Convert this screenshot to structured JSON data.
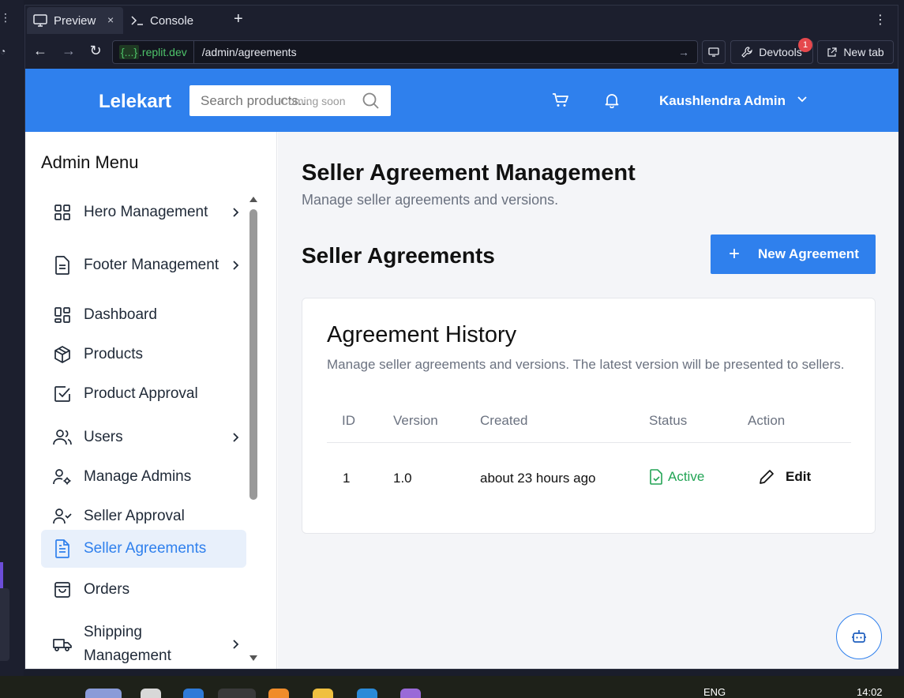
{
  "ide": {
    "tabs": [
      {
        "label": "Preview"
      },
      {
        "label": "Console"
      }
    ],
    "close_glyph": "×",
    "plus_glyph": "+",
    "url_host": "{...}",
    "url_host_suffix": ".replit.dev",
    "url_path": "/admin/agreements",
    "devtools_label": "Devtools",
    "devtools_badge": "1",
    "newtab_label": "New tab"
  },
  "topbar": {
    "brand": "Lelekart",
    "search_placeholder": "Search products...",
    "search_hint": "Coming soon",
    "user_name": "Kaushlendra Admin",
    "accent": "#2f80ed"
  },
  "sidebar": {
    "title": "Admin Menu",
    "items": [
      {
        "label": "Hero Management",
        "icon": "grid-icon",
        "chevron": true,
        "active": false
      },
      {
        "label": "Footer Management",
        "icon": "file-icon",
        "chevron": true,
        "active": false
      },
      {
        "label": "Dashboard",
        "icon": "dashboard-icon",
        "chevron": false,
        "active": false
      },
      {
        "label": "Products",
        "icon": "box-icon",
        "chevron": false,
        "active": false
      },
      {
        "label": "Product Approval",
        "icon": "check-square-icon",
        "chevron": false,
        "active": false
      },
      {
        "label": "Users",
        "icon": "users-icon",
        "chevron": true,
        "active": false
      },
      {
        "label": "Manage Admins",
        "icon": "user-cog-icon",
        "chevron": false,
        "active": false
      },
      {
        "label": "Seller Approval",
        "icon": "user-check-icon",
        "chevron": false,
        "active": false
      },
      {
        "label": "Seller Agreements",
        "icon": "file-text-icon",
        "chevron": false,
        "active": true
      },
      {
        "label": "Orders",
        "icon": "shopping-bag-icon",
        "chevron": false,
        "active": false
      },
      {
        "label": "Shipping Management",
        "icon": "truck-icon",
        "chevron": true,
        "active": false
      }
    ]
  },
  "main": {
    "title": "Seller Agreement Management",
    "subtitle": "Manage seller agreements and versions.",
    "section_title": "Seller Agreements",
    "new_button": "New Agreement",
    "card": {
      "title": "Agreement History",
      "subtitle": "Manage seller agreements and versions. The latest version will be presented to sellers.",
      "columns": [
        "ID",
        "Version",
        "Created",
        "Status",
        "Action"
      ],
      "rows": [
        {
          "id": "1",
          "version": "1.0",
          "created": "about 23 hours ago",
          "status": "Active",
          "action": "Edit"
        }
      ]
    },
    "status_color": "#22a455"
  },
  "taskbar": {
    "lang": "ENG",
    "time": "14:02"
  }
}
